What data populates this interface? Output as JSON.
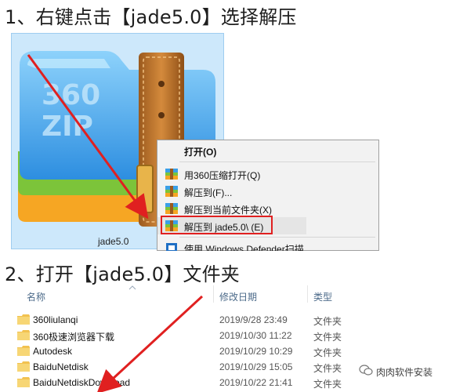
{
  "step1": {
    "title": "1、右键点击【jade5.0】选择解压",
    "icon_name": "360zip-archive-icon",
    "zip_text_line1": "360",
    "zip_text_line2": "ZIP",
    "file_label": "jade5.0"
  },
  "context_menu": {
    "items": [
      {
        "label": "打开(O)",
        "icon": null,
        "bold": true
      },
      {
        "label": "用360压缩打开(Q)",
        "icon": "360zip-small-icon"
      },
      {
        "label": "解压到(F)...",
        "icon": "360zip-small-icon"
      },
      {
        "label": "解压到当前文件夹(X)",
        "icon": "360zip-small-icon"
      },
      {
        "label": "解压到 jade5.0\\ (E)",
        "icon": "360zip-small-icon",
        "highlighted": true
      },
      {
        "label": "使用 Windows Defender扫描...",
        "icon": "windows-defender-icon"
      }
    ],
    "highlight_color": "#e02020"
  },
  "step2": {
    "title": "2、打开【jade5.0】文件夹"
  },
  "explorer": {
    "columns": [
      "名称",
      "修改日期",
      "类型"
    ],
    "rows": [
      {
        "name": "360liulanqi",
        "date": "2019/9/28 23:49",
        "type": "文件夹"
      },
      {
        "name": "360极速浏览器下载",
        "date": "2019/10/30 11:22",
        "type": "文件夹"
      },
      {
        "name": "Autodesk",
        "date": "2019/10/29 10:29",
        "type": "文件夹"
      },
      {
        "name": "BaiduNetdisk",
        "date": "2019/10/29 15:05",
        "type": "文件夹"
      },
      {
        "name": "BaiduNetdiskDownload",
        "date": "2019/10/22 21:41",
        "type": "文件夹"
      }
    ]
  },
  "watermark": {
    "text": "肉肉软件安装",
    "icon": "wechat-icon"
  },
  "colors": {
    "arrow": "#e02020",
    "folder": "#f2c250",
    "zip_blue": "#3aa0e8",
    "zip_green": "#7cc43a",
    "zip_orange": "#f6a623"
  }
}
